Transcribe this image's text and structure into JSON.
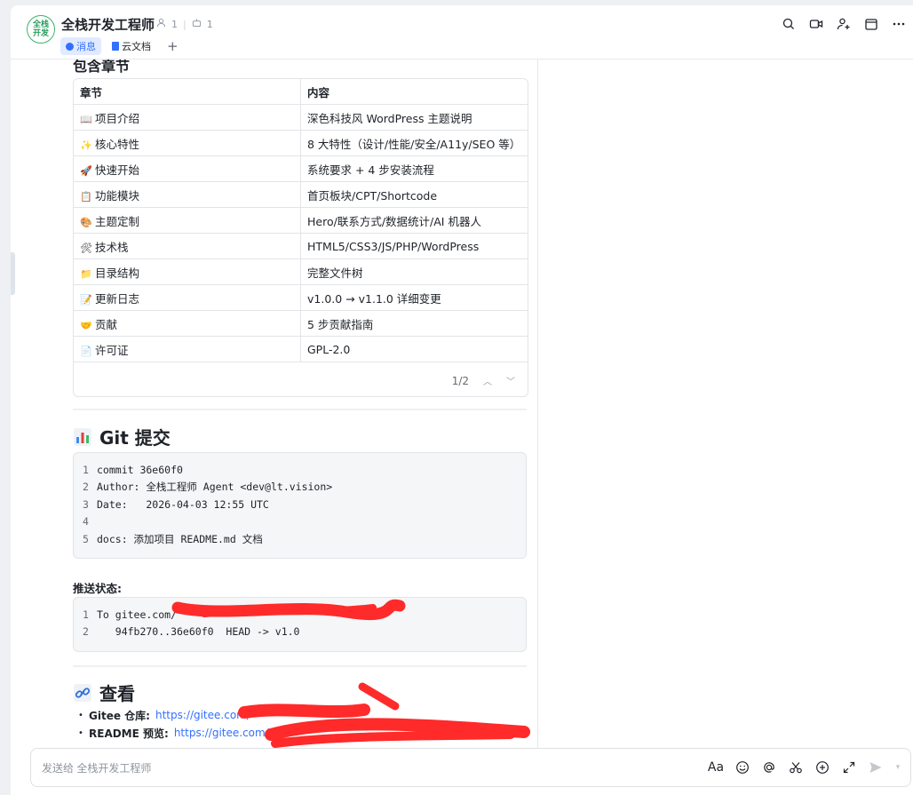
{
  "header": {
    "avatar_text": "全栈开发",
    "title": "全栈开发工程师",
    "members": "1",
    "bots": "1",
    "tabs": [
      {
        "label": "消息",
        "active": true
      },
      {
        "label": "云文档",
        "active": false
      }
    ],
    "add_tab": "+"
  },
  "section": {
    "title": "包含章节",
    "table": {
      "headers": [
        "章节",
        "内容"
      ],
      "rows": [
        {
          "emoji": "📖",
          "chapter": "项目介绍",
          "content": "深色科技风 WordPress 主题说明"
        },
        {
          "emoji": "✨",
          "chapter": "核心特性",
          "content": "8 大特性（设计/性能/安全/A11y/SEO 等）"
        },
        {
          "emoji": "🚀",
          "chapter": "快速开始",
          "content": "系统要求 + 4 步安装流程"
        },
        {
          "emoji": "📋",
          "chapter": "功能模块",
          "content": "首页板块/CPT/Shortcode"
        },
        {
          "emoji": "🎨",
          "chapter": "主题定制",
          "content": "Hero/联系方式/数据统计/AI 机器人"
        },
        {
          "emoji": "🛠",
          "chapter": "技术栈",
          "content": "HTML5/CSS3/JS/PHP/WordPress"
        },
        {
          "emoji": "📁",
          "chapter": "目录结构",
          "content": "完整文件树"
        },
        {
          "emoji": "📝",
          "chapter": "更新日志",
          "content": "v1.0.0 → v1.1.0 详细变更"
        },
        {
          "emoji": "🤝",
          "chapter": "贡献",
          "content": "5 步贡献指南"
        },
        {
          "emoji": "📄",
          "chapter": "许可证",
          "content": "GPL-2.0"
        }
      ],
      "pager": "1/2"
    }
  },
  "git": {
    "title": "Git 提交",
    "icon": "bar-chart-icon",
    "lines": [
      {
        "no": "1",
        "text": "commit 36e60f0"
      },
      {
        "no": "2",
        "text": "Author: 全栈工程师 Agent <dev@lt.vision>"
      },
      {
        "no": "3",
        "text": "Date:   2026-04-03 12:55 UTC"
      },
      {
        "no": "4",
        "text": ""
      },
      {
        "no": "5",
        "text": "docs: 添加项目 README.md 文档"
      }
    ],
    "push_label": "推送状态:",
    "push_lines": [
      {
        "no": "1",
        "text": "To gitee.com/"
      },
      {
        "no": "2",
        "text": "   94fb270..36e60f0  HEAD -> v1.0"
      }
    ]
  },
  "view": {
    "title": "查看",
    "icon": "link-icon",
    "links": [
      {
        "label": "Gitee 仓库:",
        "url": "https://gitee.com/"
      },
      {
        "label": "README 预览:",
        "url": "https://gitee.com/"
      }
    ]
  },
  "composer": {
    "placeholder": "发送给 全栈开发工程师",
    "font_label": "Aa"
  },
  "colors": {
    "accent": "#3370ff",
    "scribble": "#ff2a2a"
  }
}
